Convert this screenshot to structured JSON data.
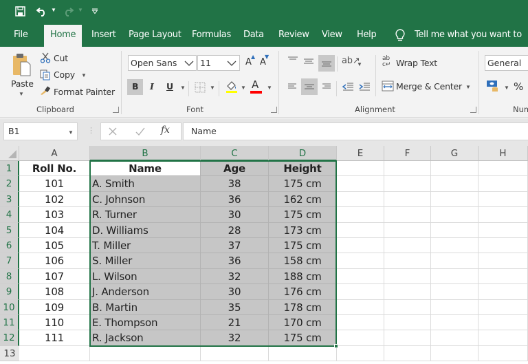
{
  "qat": {
    "save_icon": "save-icon",
    "undo_icon": "undo-icon",
    "redo_icon": "redo-icon",
    "customize_icon": "customize-qat-icon"
  },
  "tabs": [
    {
      "label": "File"
    },
    {
      "label": "Home",
      "active": true
    },
    {
      "label": "Insert"
    },
    {
      "label": "Page Layout"
    },
    {
      "label": "Formulas"
    },
    {
      "label": "Data"
    },
    {
      "label": "Review"
    },
    {
      "label": "View"
    },
    {
      "label": "Help"
    }
  ],
  "tell_me": {
    "text": "Tell me what you want to do",
    "icon": "lightbulb-icon"
  },
  "ribbon": {
    "clipboard": {
      "label": "Clipboard",
      "paste": "Paste",
      "cut": "Cut",
      "copy": "Copy",
      "format_painter": "Format Painter"
    },
    "font": {
      "label": "Font",
      "font_name": "Open Sans",
      "font_size": "11",
      "bold": "B",
      "italic": "I",
      "underline": "U",
      "font_color_letter": "A",
      "grow_letter": "A",
      "shrink_letter": "A",
      "highlight_color": "#ffff00",
      "font_color": "#ff0000"
    },
    "alignment": {
      "label": "Alignment",
      "wrap_text": "Wrap Text",
      "merge_center": "Merge & Center"
    },
    "number": {
      "label": "Num",
      "format": "General",
      "percent": "%"
    }
  },
  "formula_bar": {
    "name_box": "B1",
    "fx": "fx",
    "formula": "Name"
  },
  "sheet": {
    "columns": [
      "A",
      "B",
      "C",
      "D",
      "E",
      "F",
      "G",
      "H"
    ],
    "selected_columns": [
      "B",
      "C",
      "D"
    ],
    "rows": [
      "1",
      "2",
      "3",
      "4",
      "5",
      "6",
      "7",
      "8",
      "9",
      "10",
      "11",
      "12",
      "13"
    ],
    "selected_rows": [
      "1",
      "2",
      "3",
      "4",
      "5",
      "6",
      "7",
      "8",
      "9",
      "10",
      "11",
      "12"
    ],
    "headers": [
      "Roll No.",
      "Name",
      "Age",
      "Height"
    ],
    "data": [
      [
        "101",
        "A. Smith",
        "38",
        "175 cm"
      ],
      [
        "102",
        "C. Johnson",
        "36",
        "162 cm"
      ],
      [
        "103",
        "R. Turner",
        "30",
        "175 cm"
      ],
      [
        "104",
        "D. Williams",
        "28",
        "173 cm"
      ],
      [
        "105",
        "T. Miller",
        "37",
        "175 cm"
      ],
      [
        "106",
        "S. Miller",
        "36",
        "158 cm"
      ],
      [
        "107",
        "L. Wilson",
        "32",
        "188 cm"
      ],
      [
        "108",
        "J. Anderson",
        "30",
        "176 cm"
      ],
      [
        "109",
        "B. Martin",
        "35",
        "178 cm"
      ],
      [
        "110",
        "E. Thompson",
        "21",
        "170 cm"
      ],
      [
        "111",
        "R. Jackson",
        "32",
        "175 cm"
      ]
    ],
    "selection_range": "B1:D12",
    "accent_color": "#217346"
  }
}
